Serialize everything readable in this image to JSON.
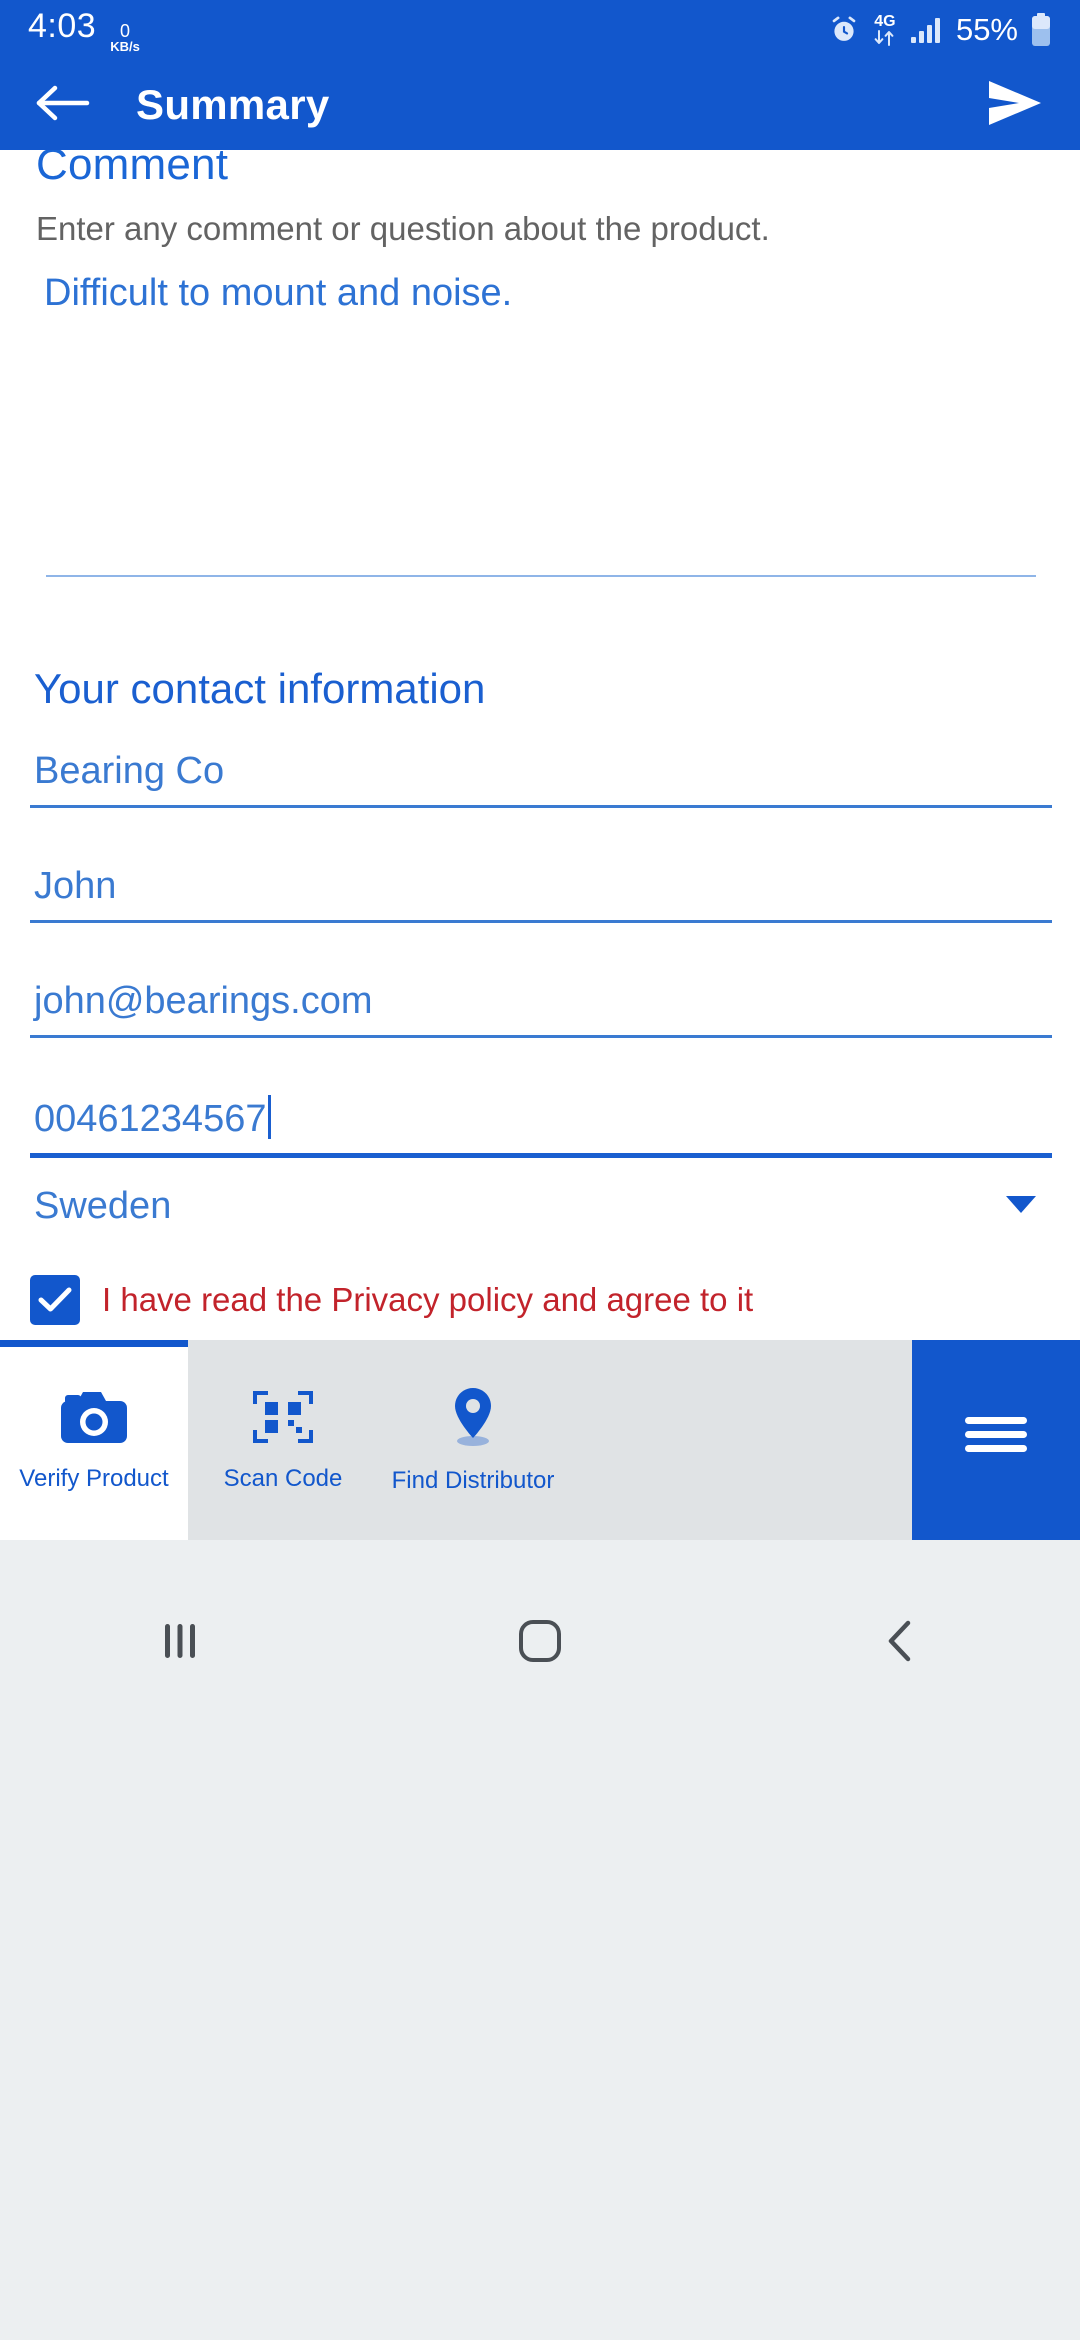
{
  "status_bar": {
    "time": "4:03",
    "network_speed_value": "0",
    "network_speed_unit": "KB/s",
    "network_type": "4G",
    "battery_percent": "55%",
    "icons": [
      "alarm-icon",
      "data-transfer-icon",
      "signal-bars-icon",
      "battery-icon"
    ]
  },
  "app_bar": {
    "title": "Summary",
    "back_icon": "arrow-left-icon",
    "send_icon": "send-icon"
  },
  "comment_section": {
    "heading": "Comment",
    "hint": "Enter any comment or question about the product.",
    "value": "Difficult to mount and noise."
  },
  "contact_section": {
    "heading": "Your contact information",
    "fields": [
      {
        "name": "company",
        "value": "Bearing Co",
        "focused": false
      },
      {
        "name": "contact-name",
        "value": "John",
        "focused": false
      },
      {
        "name": "email",
        "value": "john@bearings.com",
        "focused": false
      },
      {
        "name": "phone",
        "value": "00461234567",
        "focused": true
      }
    ],
    "country": {
      "value": "Sweden",
      "arrow_icon": "chevron-down-icon"
    },
    "privacy": {
      "label": "I have read the Privacy policy and agree to it",
      "checked": true
    }
  },
  "bottom_tabs": [
    {
      "label": "Verify Product",
      "icon": "camera-icon",
      "active": true
    },
    {
      "label": "Scan Code",
      "icon": "qr-code-icon",
      "active": false
    },
    {
      "label": "Find Distributor",
      "icon": "map-pin-icon",
      "active": false
    }
  ],
  "menu_button": {
    "icon": "hamburger-menu-icon"
  },
  "android_nav": {
    "recents_icon": "recents-icon",
    "home_icon": "home-icon",
    "back_icon": "back-chevron-icon"
  },
  "colors": {
    "brand_blue": "#1257cc",
    "field_blue": "#3a7ad1",
    "privacy_red": "#c2232b",
    "tab_inactive_bg": "#e0e3e5"
  }
}
